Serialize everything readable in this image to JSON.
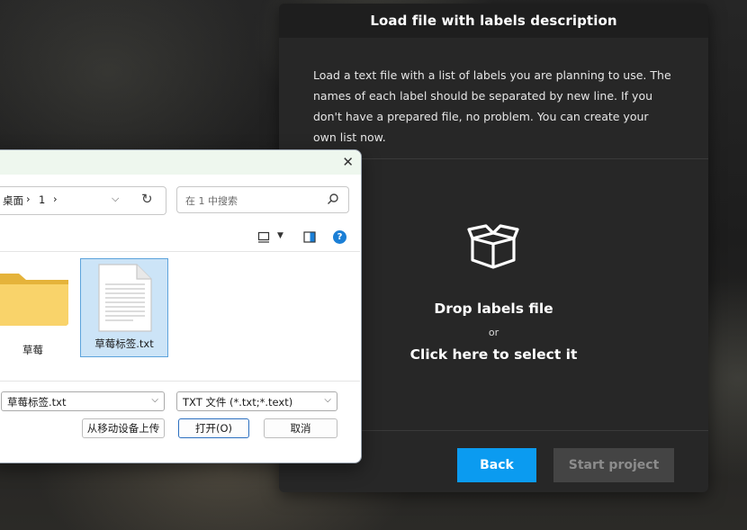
{
  "modal": {
    "title": "Load file with labels description",
    "description": "Load a text file with a list of labels you are planning to use. The names of each label should be separated by new line. If you don't have a prepared file, no problem. You can create your own list now.",
    "drop_title": "Drop labels file",
    "drop_or": "or",
    "drop_click": "Click here to select it",
    "back_label": "Back",
    "start_label": "Start project",
    "colors": {
      "accent": "#0b9bf0",
      "panel": "#272727",
      "header": "#1e1e1e",
      "disabled": "#444444"
    }
  },
  "dialog": {
    "close_glyph": "✕",
    "breadcrumb": {
      "desktop": "桌面",
      "sep": "›",
      "folder": "1"
    },
    "search_placeholder": "在 1 中搜索",
    "help_glyph": "?",
    "items": [
      {
        "label": "草莓",
        "icon": "folder-icon",
        "selected": false
      },
      {
        "label": "草莓标签.txt",
        "icon": "text-file-icon",
        "selected": true
      }
    ],
    "filename_value": "草莓标签.txt",
    "filter_value": "TXT 文件 (*.txt;*.text)",
    "upload_label": "从移动设备上传",
    "open_label": "打开(O)",
    "cancel_label": "取消"
  }
}
